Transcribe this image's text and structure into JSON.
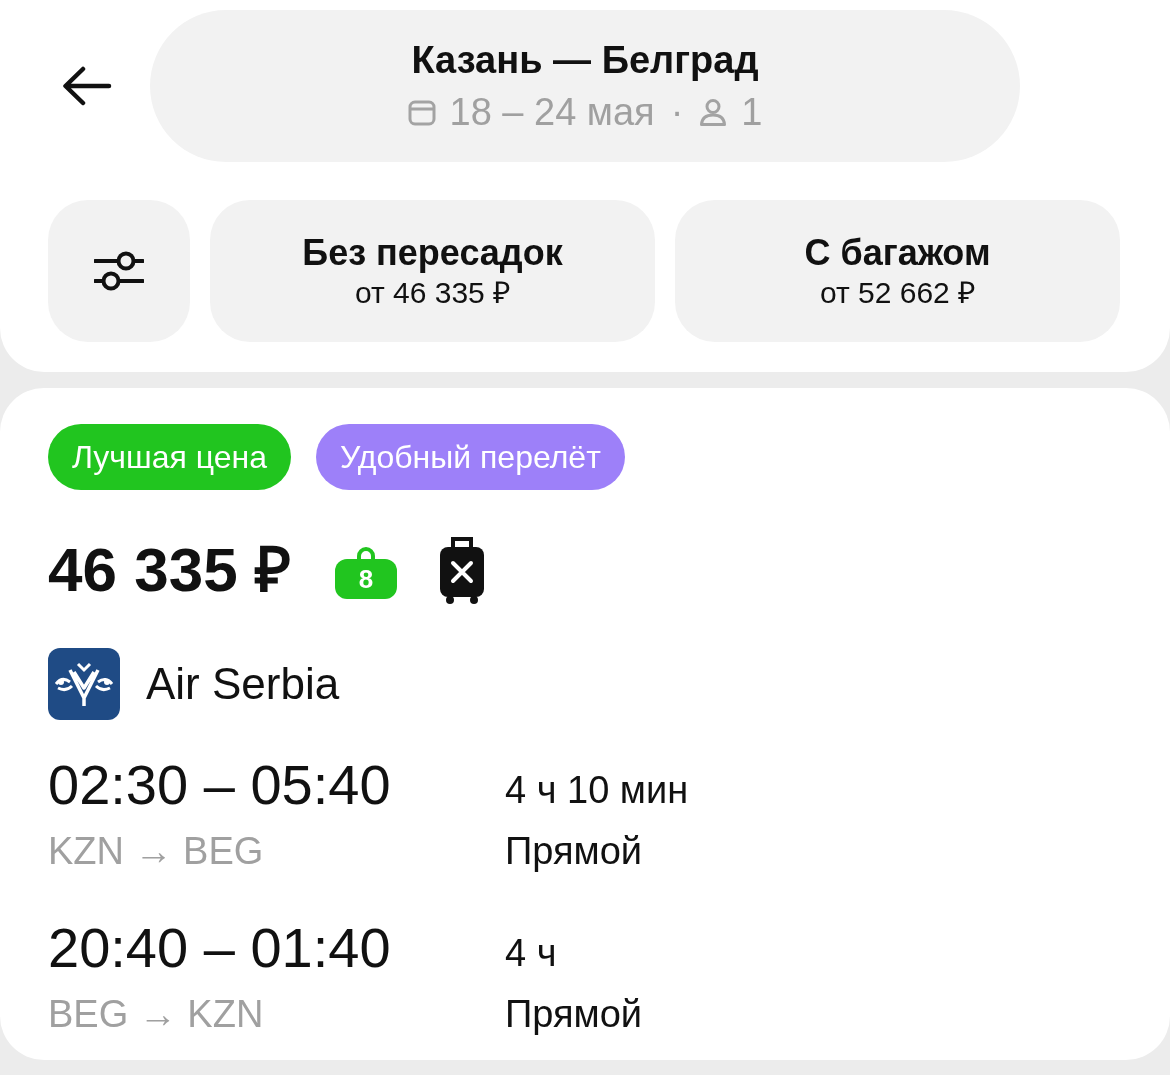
{
  "header": {
    "route": "Казань — Белград",
    "dates": "18 – 24 мая",
    "separator": "·",
    "passengers": "1"
  },
  "filters": [
    {
      "title": "Без пересадок",
      "price": "от 46 335 ₽",
      "selected": false
    },
    {
      "title": "С багажом",
      "price": "от 52 662 ₽",
      "selected": false
    }
  ],
  "offer": {
    "tags": [
      {
        "label": "Лучшая цена",
        "color": "#21c51f"
      },
      {
        "label": "Удобный перелёт",
        "color": "#9d80f9"
      }
    ],
    "price": "46 335 ₽",
    "luggage": [
      {
        "kind": "hand",
        "included": true,
        "weight": "8"
      },
      {
        "kind": "checked",
        "included": false
      }
    ],
    "airline": "Air Serbia",
    "legs": [
      {
        "times": "02:30 – 05:40",
        "route": "KZN → BEG",
        "duration": "4 ч 10 мин",
        "stops": "Прямой"
      },
      {
        "times": "20:40 – 01:40",
        "route": "BEG → KZN",
        "duration": "4 ч",
        "stops": "Прямой"
      }
    ]
  }
}
